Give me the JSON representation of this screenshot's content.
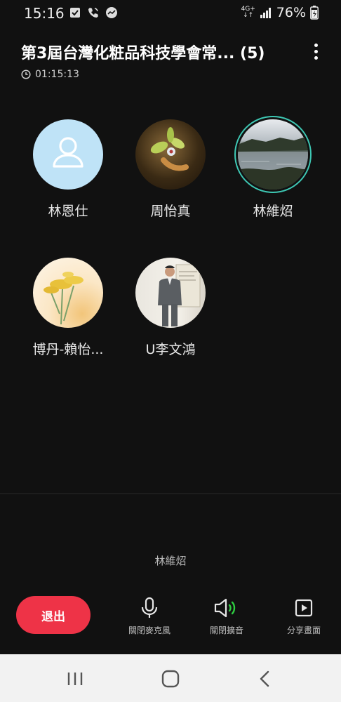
{
  "status": {
    "time": "15:16",
    "network": "4G+",
    "battery": "76%"
  },
  "header": {
    "title": "第3屆台灣化粧品科技學會常... (5)",
    "timer": "01:15:13"
  },
  "participants": [
    {
      "name": "林恩仕"
    },
    {
      "name": "周怡真"
    },
    {
      "name": "林維炤"
    },
    {
      "name": "博丹-賴怡..."
    },
    {
      "name": "U李文鴻"
    }
  ],
  "speaking": {
    "name": "林維炤"
  },
  "controls": {
    "exit": "退出",
    "mic": "關閉麥克風",
    "speaker": "關閉擴音",
    "share": "分享畫面"
  },
  "colors": {
    "accent": "#3ec8b4",
    "exit": "#ee3347",
    "speaker_wave": "#2ecc40"
  }
}
